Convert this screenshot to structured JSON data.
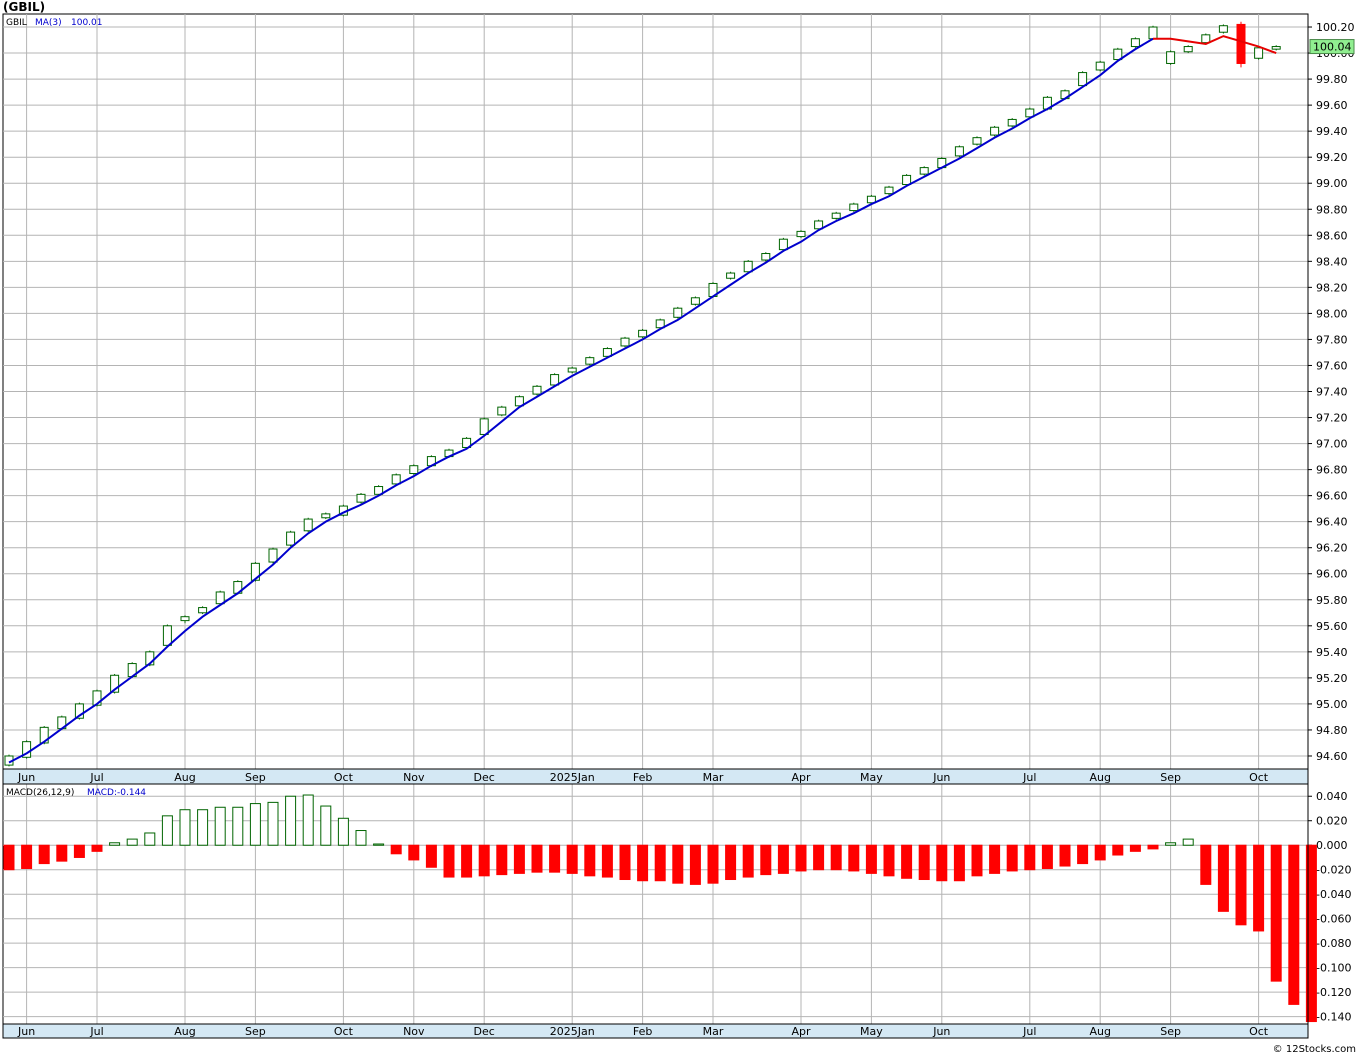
{
  "header": {
    "title": "(GBIL)",
    "credit": "© 12Stocks.com"
  },
  "chart_data": [
    {
      "type": "candlestick",
      "ticker": "GBIL",
      "legend": {
        "ticker_label": "GBIL",
        "ma_label": "MA(3)",
        "ma_value": "100.01"
      },
      "current_price_label": "100.04",
      "ylim": [
        94.5,
        100.3
      ],
      "y_ticks": [
        "100.20",
        "100.00",
        "99.80",
        "99.60",
        "99.40",
        "99.20",
        "99.00",
        "98.80",
        "98.60",
        "98.40",
        "98.20",
        "98.00",
        "97.80",
        "97.60",
        "97.40",
        "97.20",
        "97.00",
        "96.80",
        "96.60",
        "96.40",
        "96.20",
        "96.00",
        "95.80",
        "95.60",
        "95.40",
        "95.20",
        "95.00",
        "94.80",
        "94.60"
      ],
      "x_labels": [
        {
          "label": "Jun",
          "i": 1
        },
        {
          "label": "Jul",
          "i": 5
        },
        {
          "label": "Aug",
          "i": 10
        },
        {
          "label": "Sep",
          "i": 14
        },
        {
          "label": "Oct",
          "i": 19
        },
        {
          "label": "Nov",
          "i": 23
        },
        {
          "label": "Dec",
          "i": 27
        },
        {
          "label": "2025Jan",
          "i": 32
        },
        {
          "label": "Feb",
          "i": 36
        },
        {
          "label": "Mar",
          "i": 40
        },
        {
          "label": "Apr",
          "i": 45
        },
        {
          "label": "May",
          "i": 49
        },
        {
          "label": "Jun",
          "i": 53
        },
        {
          "label": "Jul",
          "i": 58
        },
        {
          "label": "Aug",
          "i": 62
        },
        {
          "label": "Sep",
          "i": 66
        },
        {
          "label": "Oct",
          "i": 71
        }
      ],
      "candles": [
        [
          94.52,
          94.61,
          94.53,
          94.6
        ],
        [
          94.58,
          94.72,
          94.59,
          94.71
        ],
        [
          94.69,
          94.83,
          94.7,
          94.82
        ],
        [
          94.8,
          94.91,
          94.81,
          94.9
        ],
        [
          94.88,
          95.01,
          94.89,
          95.0
        ],
        [
          94.98,
          95.11,
          94.99,
          95.1
        ],
        [
          95.08,
          95.23,
          95.09,
          95.22
        ],
        [
          95.2,
          95.32,
          95.21,
          95.31
        ],
        [
          95.29,
          95.41,
          95.3,
          95.4
        ],
        [
          95.44,
          95.61,
          95.45,
          95.6
        ],
        [
          95.62,
          95.68,
          95.64,
          95.67
        ],
        [
          95.69,
          95.75,
          95.7,
          95.74
        ],
        [
          95.76,
          95.87,
          95.77,
          95.86
        ],
        [
          95.84,
          95.95,
          95.85,
          95.94
        ],
        [
          95.94,
          96.09,
          95.95,
          96.08
        ],
        [
          96.08,
          96.2,
          96.09,
          96.19
        ],
        [
          96.21,
          96.33,
          96.22,
          96.32
        ],
        [
          96.32,
          96.43,
          96.33,
          96.42
        ],
        [
          96.42,
          96.47,
          96.43,
          96.46
        ],
        [
          96.44,
          96.53,
          96.45,
          96.52
        ],
        [
          96.54,
          96.62,
          96.55,
          96.61
        ],
        [
          96.6,
          96.68,
          96.61,
          96.67
        ],
        [
          96.68,
          96.77,
          96.69,
          96.76
        ],
        [
          96.76,
          96.84,
          96.77,
          96.83
        ],
        [
          96.82,
          96.91,
          96.83,
          96.9
        ],
        [
          96.89,
          96.96,
          96.9,
          96.95
        ],
        [
          96.96,
          97.05,
          96.97,
          97.04
        ],
        [
          97.06,
          97.2,
          97.07,
          97.19
        ],
        [
          97.21,
          97.29,
          97.22,
          97.28
        ],
        [
          97.28,
          97.37,
          97.29,
          97.36
        ],
        [
          97.37,
          97.45,
          97.38,
          97.44
        ],
        [
          97.44,
          97.54,
          97.45,
          97.53
        ],
        [
          97.54,
          97.59,
          97.55,
          97.58
        ],
        [
          97.6,
          97.67,
          97.61,
          97.66
        ],
        [
          97.66,
          97.74,
          97.67,
          97.73
        ],
        [
          97.74,
          97.82,
          97.75,
          97.81
        ],
        [
          97.81,
          97.88,
          97.82,
          97.87
        ],
        [
          97.88,
          97.96,
          97.89,
          97.95
        ],
        [
          97.96,
          98.05,
          97.97,
          98.04
        ],
        [
          98.06,
          98.13,
          98.07,
          98.12
        ],
        [
          98.12,
          98.24,
          98.13,
          98.23
        ],
        [
          98.26,
          98.32,
          98.27,
          98.31
        ],
        [
          98.31,
          98.41,
          98.32,
          98.4
        ],
        [
          98.4,
          98.47,
          98.41,
          98.46
        ],
        [
          98.48,
          98.58,
          98.49,
          98.57
        ],
        [
          98.58,
          98.64,
          98.59,
          98.63
        ],
        [
          98.64,
          98.72,
          98.65,
          98.71
        ],
        [
          98.72,
          98.78,
          98.73,
          98.77
        ],
        [
          98.78,
          98.85,
          98.79,
          98.84
        ],
        [
          98.84,
          98.91,
          98.85,
          98.9
        ],
        [
          98.91,
          98.98,
          98.92,
          98.97
        ],
        [
          98.98,
          99.07,
          98.99,
          99.06
        ],
        [
          99.06,
          99.13,
          99.07,
          99.12
        ],
        [
          99.11,
          99.2,
          99.12,
          99.19
        ],
        [
          99.2,
          99.29,
          99.21,
          99.28
        ],
        [
          99.29,
          99.36,
          99.3,
          99.35
        ],
        [
          99.36,
          99.44,
          99.37,
          99.43
        ],
        [
          99.43,
          99.5,
          99.44,
          99.49
        ],
        [
          99.5,
          99.58,
          99.51,
          99.57
        ],
        [
          99.56,
          99.67,
          99.57,
          99.66
        ],
        [
          99.64,
          99.72,
          99.65,
          99.71
        ],
        [
          99.74,
          99.86,
          99.75,
          99.85
        ],
        [
          99.86,
          99.94,
          99.87,
          99.93
        ],
        [
          99.94,
          100.04,
          99.95,
          100.03
        ],
        [
          100.04,
          100.12,
          100.05,
          100.11
        ],
        [
          100.1,
          100.21,
          100.11,
          100.2
        ],
        [
          99.91,
          100.02,
          99.92,
          100.01
        ],
        [
          100.0,
          100.06,
          100.01,
          100.05
        ],
        [
          100.07,
          100.15,
          100.08,
          100.14
        ],
        [
          100.15,
          100.22,
          100.16,
          100.21
        ],
        [
          99.89,
          100.24,
          100.22,
          99.92
        ],
        [
          99.95,
          100.05,
          99.96,
          100.04
        ],
        [
          100.02,
          100.06,
          100.03,
          100.05
        ]
      ],
      "ma3": [
        94.55,
        94.62,
        94.71,
        94.81,
        94.91,
        95.0,
        95.11,
        95.21,
        95.31,
        95.44,
        95.56,
        95.67,
        95.76,
        95.85,
        95.96,
        96.07,
        96.2,
        96.31,
        96.4,
        96.47,
        96.53,
        96.6,
        96.68,
        96.75,
        96.83,
        96.9,
        96.96,
        97.06,
        97.17,
        97.28,
        97.36,
        97.44,
        97.52,
        97.59,
        97.66,
        97.73,
        97.8,
        97.88,
        97.95,
        98.04,
        98.13,
        98.22,
        98.31,
        98.39,
        98.48,
        98.55,
        98.64,
        98.71,
        98.77,
        98.84,
        98.9,
        98.98,
        99.05,
        99.12,
        99.19,
        99.27,
        99.35,
        99.42,
        99.5,
        99.57,
        99.65,
        99.74,
        99.83,
        99.94,
        100.03,
        100.11,
        100.11,
        100.09,
        100.07,
        100.13,
        100.09,
        100.05,
        100.0
      ],
      "ma3_color_change_index": 65
    },
    {
      "type": "bar",
      "name": "MACD",
      "legend": {
        "label": "MACD(26,12,9)",
        "value_label": "MACD:-0.144"
      },
      "ylim": [
        -0.146,
        0.05
      ],
      "y_ticks": [
        "0.040",
        "0.020",
        "0.000",
        "-0.020",
        "-0.040",
        "-0.060",
        "-0.080",
        "-0.100",
        "-0.120",
        "-0.140"
      ],
      "values": [
        -0.02,
        -0.019,
        -0.015,
        -0.013,
        -0.01,
        -0.005,
        0.002,
        0.005,
        0.01,
        0.024,
        0.029,
        0.029,
        0.031,
        0.031,
        0.034,
        0.035,
        0.04,
        0.041,
        0.032,
        0.022,
        0.012,
        0.001,
        -0.007,
        -0.012,
        -0.018,
        -0.026,
        -0.026,
        -0.025,
        -0.024,
        -0.023,
        -0.022,
        -0.022,
        -0.023,
        -0.025,
        -0.026,
        -0.028,
        -0.029,
        -0.029,
        -0.031,
        -0.032,
        -0.031,
        -0.028,
        -0.026,
        -0.024,
        -0.023,
        -0.021,
        -0.02,
        -0.02,
        -0.021,
        -0.023,
        -0.025,
        -0.027,
        -0.028,
        -0.029,
        -0.029,
        -0.025,
        -0.023,
        -0.021,
        -0.02,
        -0.019,
        -0.017,
        -0.015,
        -0.012,
        -0.008,
        -0.005,
        -0.003,
        0.002,
        0.005,
        -0.032,
        -0.054,
        -0.065,
        -0.07,
        -0.111,
        -0.13,
        -0.144
      ]
    }
  ],
  "colors": {
    "background": "#ffffff",
    "grid": "#b4b4b4",
    "up_candle_fill": "#ffffff",
    "up_candle_stroke": "#006400",
    "down_candle": "#ff0000",
    "ma_line": "#0000cd",
    "ma_line_recent": "#e60000",
    "macd_pos_stroke": "#006400",
    "macd_neg": "#ff0000",
    "axis_band": "#d4e8f4",
    "price_tag": "#90ee90",
    "label_text": "#000000"
  }
}
